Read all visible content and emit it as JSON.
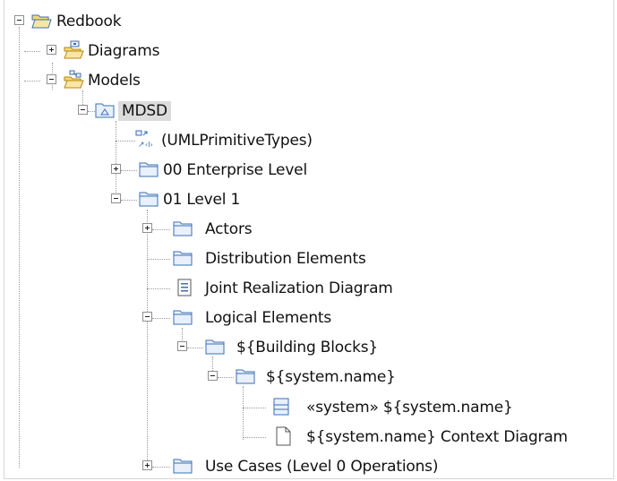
{
  "tree": {
    "root": {
      "label": "Redbook",
      "icon": "open-folder-icon",
      "expanded": true
    },
    "diagrams": {
      "label": "Diagrams",
      "icon": "diagrams-folder-icon",
      "expanded": false
    },
    "models": {
      "label": "Models",
      "icon": "models-folder-icon",
      "expanded": true
    },
    "mdsd": {
      "label": "MDSD",
      "icon": "model-icon",
      "expanded": true,
      "selected": true
    },
    "uml_primitive_types": {
      "label": "(UMLPrimitiveTypes)",
      "icon": "library-reference-icon"
    },
    "enterprise_level": {
      "label": "00 Enterprise Level",
      "icon": "package-icon",
      "expanded": false
    },
    "level1": {
      "label": "01 Level 1",
      "icon": "package-icon",
      "expanded": true
    },
    "actors": {
      "label": "Actors",
      "icon": "package-icon",
      "expanded": false
    },
    "distribution_elements": {
      "label": "Distribution Elements",
      "icon": "package-icon"
    },
    "joint_realization_diagram": {
      "label": "Joint Realization Diagram",
      "icon": "diagram-icon"
    },
    "logical_elements": {
      "label": "Logical Elements",
      "icon": "package-icon",
      "expanded": true
    },
    "building_blocks": {
      "label": "${Building Blocks}",
      "icon": "package-icon",
      "expanded": true
    },
    "system_name_pkg": {
      "label": "${system.name}",
      "icon": "package-icon",
      "expanded": true
    },
    "system_class": {
      "label": "«system» ${system.name}",
      "icon": "class-icon"
    },
    "context_diagram": {
      "label": "${system.name} Context Diagram",
      "icon": "document-icon"
    },
    "use_cases": {
      "label": "Use Cases (Level 0 Operations)",
      "icon": "package-icon",
      "expanded": false
    }
  },
  "colors": {
    "folder_blue": "#3b6fb6",
    "folder_fill": "#e8f0fb",
    "open_folder_yellow": "#f5d67a",
    "selection": "#dcdcdc",
    "tree_lines": "#9a9a9a"
  }
}
